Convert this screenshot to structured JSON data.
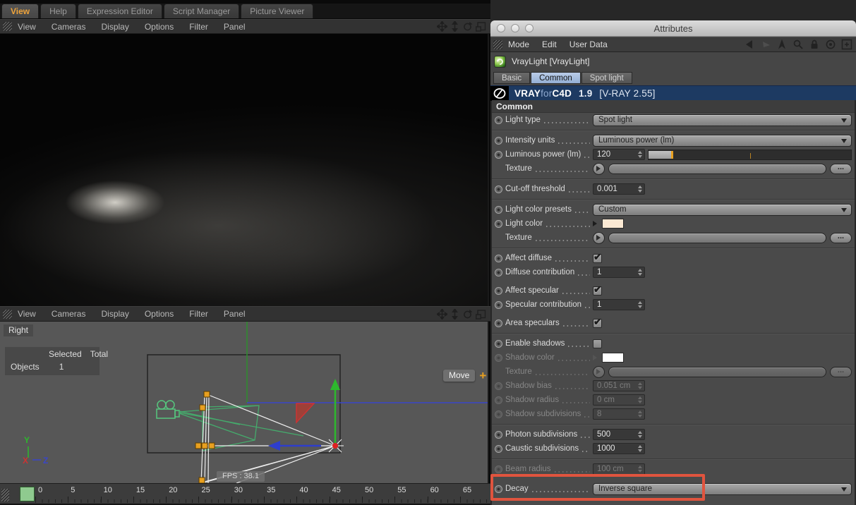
{
  "colors": {
    "accent_orange": "#eda33b",
    "highlight_red": "#e0543e",
    "banner_blue": "#1d3a62",
    "timeline_marker_green": "#8fca8f",
    "light_color_swatch": "#fbe9d3",
    "shadow_color_swatch": "#ffffff",
    "slider_tick_orange": "#e8a020",
    "selection_green": "#56c77e"
  },
  "left": {
    "window_tabs": [
      {
        "label": "View",
        "active": true
      },
      {
        "label": "Help",
        "active": false
      },
      {
        "label": "Expression Editor",
        "active": false
      },
      {
        "label": "Script Manager",
        "active": false
      },
      {
        "label": "Picture Viewer",
        "active": false
      }
    ],
    "viewport1_menu": [
      "View",
      "Cameras",
      "Display",
      "Options",
      "Filter",
      "Panel"
    ],
    "viewport2_menu": [
      "View",
      "Cameras",
      "Display",
      "Options",
      "Filter",
      "Panel"
    ],
    "viewport2": {
      "view_label": "Right",
      "stats": {
        "col_selected": "Selected",
        "col_total": "Total",
        "row_label": "Objects",
        "objects_selected": "1"
      },
      "fps": "FPS : 38.1",
      "move_tooltip": "Move",
      "axis": {
        "x": "X",
        "y": "Y",
        "z": "Z"
      }
    },
    "timeline_labels": [
      "0",
      "5",
      "10",
      "15",
      "20",
      "25",
      "30",
      "35",
      "40",
      "45",
      "50",
      "55",
      "60",
      "65"
    ]
  },
  "attributes": {
    "title": "Attributes",
    "menu": [
      "Mode",
      "Edit",
      "User Data"
    ],
    "object_name": "VrayLight [VrayLight]",
    "tabs": [
      {
        "label": "Basic",
        "active": false
      },
      {
        "label": "Common",
        "active": true
      },
      {
        "label": "Spot light",
        "active": false
      }
    ],
    "banner": {
      "vray": "VRAY",
      "for": "for",
      "c4d": "C4D",
      "version": "1.9",
      "release": "[V-RAY 2.55]"
    },
    "texture_browse_label": "...",
    "rows": [
      {
        "type": "header",
        "label": "Common"
      },
      {
        "type": "dropdown",
        "label": "Light type",
        "value": "Spot light"
      },
      {
        "type": "sep"
      },
      {
        "type": "dropdown",
        "label": "Intensity units",
        "value": "Luminous power (lm)"
      },
      {
        "type": "number-slider",
        "label": "Luminous power (lm)",
        "value": "120",
        "fill_pct": 11,
        "tick_pct": 50
      },
      {
        "type": "texture",
        "label": "Texture"
      },
      {
        "type": "sep"
      },
      {
        "type": "number",
        "label": "Cut-off threshold",
        "value": "0.001"
      },
      {
        "type": "sep"
      },
      {
        "type": "dropdown",
        "label": "Light color presets",
        "value": "Custom"
      },
      {
        "type": "swatch",
        "label": "Light color",
        "swatch": "light_color_swatch"
      },
      {
        "type": "texture",
        "label": "Texture"
      },
      {
        "type": "sep"
      },
      {
        "type": "check",
        "label": "Affect diffuse",
        "checked": true
      },
      {
        "type": "number",
        "label": "Diffuse contribution",
        "value": "1"
      },
      {
        "type": "gap6"
      },
      {
        "type": "check",
        "label": "Affect specular",
        "checked": true
      },
      {
        "type": "number",
        "label": "Specular contribution",
        "value": "1"
      },
      {
        "type": "gap6"
      },
      {
        "type": "check",
        "label": "Area speculars",
        "checked": true
      },
      {
        "type": "sep"
      },
      {
        "type": "check",
        "label": "Enable shadows",
        "checked": false
      },
      {
        "type": "swatch",
        "label": "Shadow color",
        "swatch": "shadow_color_swatch",
        "disabled": true
      },
      {
        "type": "texture",
        "label": "Texture",
        "disabled": true
      },
      {
        "type": "number",
        "label": "Shadow bias",
        "value": "0.051 cm",
        "disabled": true
      },
      {
        "type": "number",
        "label": "Shadow radius",
        "value": "0 cm",
        "disabled": true
      },
      {
        "type": "number",
        "label": "Shadow subdivisions",
        "value": "8",
        "disabled": true
      },
      {
        "type": "sep"
      },
      {
        "type": "number",
        "label": "Photon subdivisions",
        "value": "500"
      },
      {
        "type": "number",
        "label": "Caustic subdivisions",
        "value": "1000"
      },
      {
        "type": "sep"
      },
      {
        "type": "number",
        "label": "Beam radius",
        "value": "100 cm",
        "disabled": true
      },
      {
        "type": "gap8"
      },
      {
        "type": "dropdown",
        "label": "Decay",
        "value": "Inverse square",
        "highlight": true
      }
    ]
  }
}
